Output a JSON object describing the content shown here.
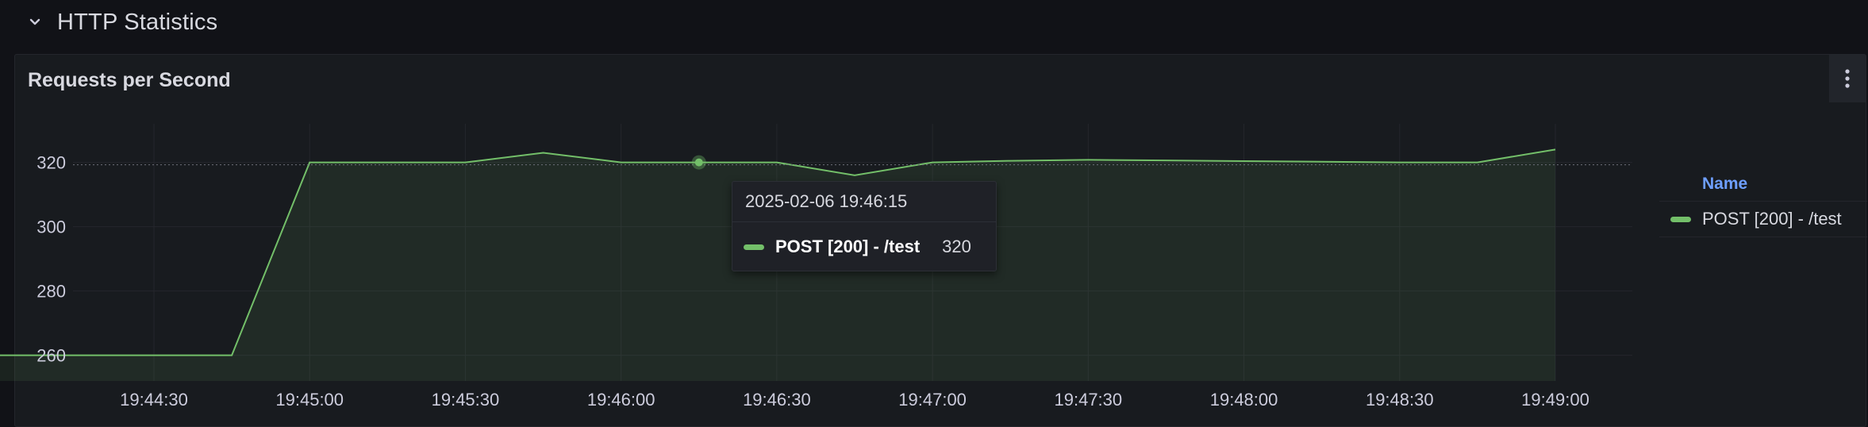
{
  "row": {
    "title": "HTTP Statistics",
    "chevron_icon": "chevron-down-icon"
  },
  "panel": {
    "title": "Requests per Second",
    "menu_icon": "kebab-menu-icon"
  },
  "legend": {
    "header": "Name",
    "items": [
      {
        "label": "POST [200] - /test",
        "color": "#73bf69"
      }
    ]
  },
  "tooltip": {
    "timestamp": "2025-02-06 19:46:15",
    "series_label": "POST [200] - /test",
    "value": "320"
  },
  "chart_data": {
    "type": "area",
    "x_tick_labels": [
      "19:44:30",
      "19:45:00",
      "19:45:30",
      "19:46:00",
      "19:46:30",
      "19:47:00",
      "19:47:30",
      "19:48:00",
      "19:48:30",
      "19:49:00"
    ],
    "y_tick_labels": [
      "260",
      "280",
      "300",
      "320"
    ],
    "ylim": [
      252,
      332
    ],
    "grid": true,
    "legend_position": "right",
    "series": [
      {
        "name": "POST [200] - /test",
        "color": "#73bf69",
        "x": [
          "19:44:00",
          "19:44:15",
          "19:44:30",
          "19:44:45",
          "19:45:00",
          "19:45:15",
          "19:45:30",
          "19:45:45",
          "19:46:00",
          "19:46:15",
          "19:46:30",
          "19:46:45",
          "19:47:00",
          "19:47:15",
          "19:47:30",
          "19:47:45",
          "19:48:00",
          "19:48:15",
          "19:48:30",
          "19:48:45",
          "19:49:00"
        ],
        "values": [
          260,
          260,
          260,
          260,
          320,
          320,
          320,
          323,
          320,
          320,
          320,
          316,
          320,
          320.5,
          320.8,
          320.6,
          320.4,
          320.2,
          320,
          320,
          324
        ]
      }
    ],
    "hover": {
      "x": "19:46:15",
      "y": 320
    }
  }
}
